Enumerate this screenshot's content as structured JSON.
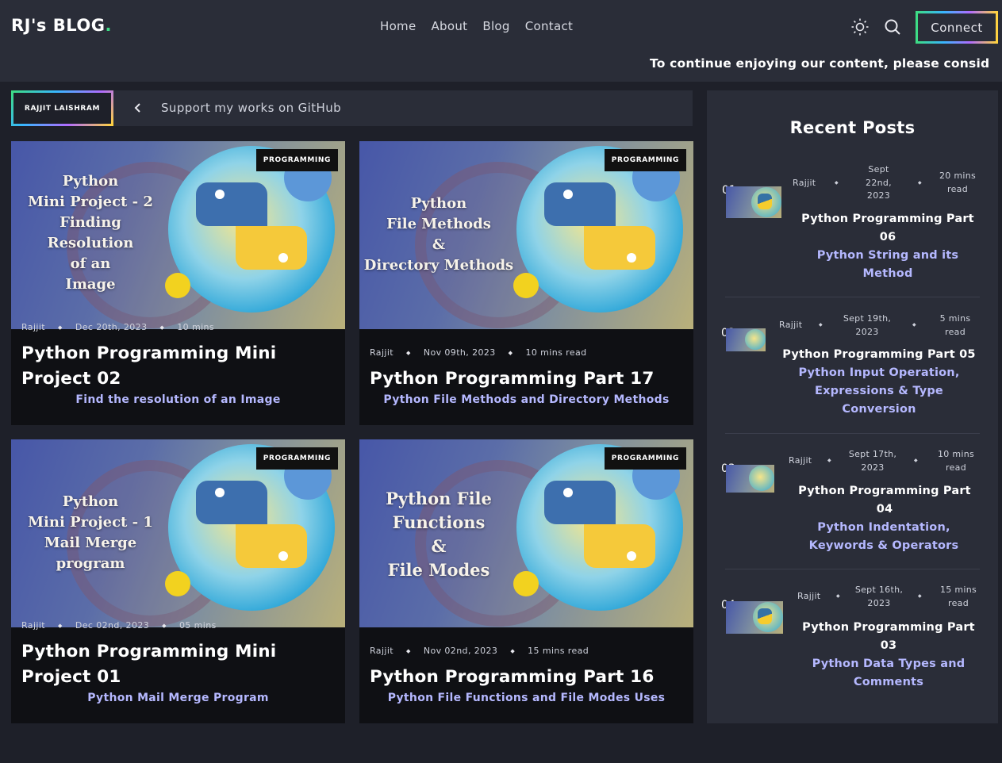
{
  "header": {
    "logo": "RJ's BLOG",
    "logo_dot": ".",
    "nav": [
      "Home",
      "About",
      "Blog",
      "Contact"
    ],
    "connect_label": "Connect",
    "ticker": "To continue enjoying our content, please consid"
  },
  "subbar": {
    "author_tag": "RAJJIT LAISHRAM",
    "support_text": "Support my works on GitHub"
  },
  "cards": [
    {
      "category": "PROGRAMMING",
      "thumb_lines": [
        "Python",
        "Mini Project - 2",
        "Finding",
        "Resolution",
        "of an",
        "Image"
      ],
      "author": "Rajjit",
      "date": "Dec 20th, 2023",
      "read": "10 mins",
      "title": "Python Programming Mini Project 02",
      "subtitle": "Find the resolution of an Image"
    },
    {
      "category": "PROGRAMMING",
      "thumb_lines": [
        "Python",
        "File Methods",
        "&",
        "Directory Methods"
      ],
      "author": "Rajjit",
      "date": "Nov 09th, 2023",
      "read": "10 mins read",
      "title": "Python Programming Part 17",
      "subtitle": "Python File Methods and Directory Methods"
    },
    {
      "category": "PROGRAMMING",
      "thumb_lines": [
        "Python",
        "Mini Project - 1",
        "Mail Merge",
        "program"
      ],
      "author": "Rajjit",
      "date": "Dec 02nd, 2023",
      "read": "05 mins",
      "title": "Python Programming Mini Project 01",
      "subtitle": "Python Mail Merge Program"
    },
    {
      "category": "PROGRAMMING",
      "thumb_lines": [
        "Python File",
        "Functions",
        "&",
        "File Modes"
      ],
      "author": "Rajjit",
      "date": "Nov 02nd, 2023",
      "read": "15 mins read",
      "title": "Python Programming Part 16",
      "subtitle": "Python File Functions and File Modes Uses"
    }
  ],
  "sidebar": {
    "heading": "Recent Posts",
    "posts": [
      {
        "num": "01",
        "author": "Rajjit",
        "date": "Sept 22nd, 2023",
        "read": "20 mins read",
        "title": "Python Programming Part 06",
        "subtitle": "Python String and its Method"
      },
      {
        "num": "02",
        "author": "Rajjit",
        "date": "Sept 19th, 2023",
        "read": "5 mins read",
        "title": "Python Programming Part 05",
        "subtitle": "Python Input Operation, Expressions & Type Conversion"
      },
      {
        "num": "03",
        "author": "Rajjit",
        "date": "Sept 17th, 2023",
        "read": "10 mins read",
        "title": "Python Programming Part 04",
        "subtitle": "Python Indentation, Keywords & Operators"
      },
      {
        "num": "04",
        "author": "Rajjit",
        "date": "Sept 16th, 2023",
        "read": "15 mins read",
        "title": "Python Programming Part 03",
        "subtitle": "Python Data Types and Comments"
      }
    ]
  },
  "icons": {
    "theme": "sun-icon",
    "search": "search-icon",
    "prev": "chevron-left-icon"
  },
  "colors": {
    "page_bg": "#1e2029",
    "panel_bg": "#2a2d38",
    "accent_text": "#b5b8ff",
    "logo_dot": "#3ddc84"
  }
}
